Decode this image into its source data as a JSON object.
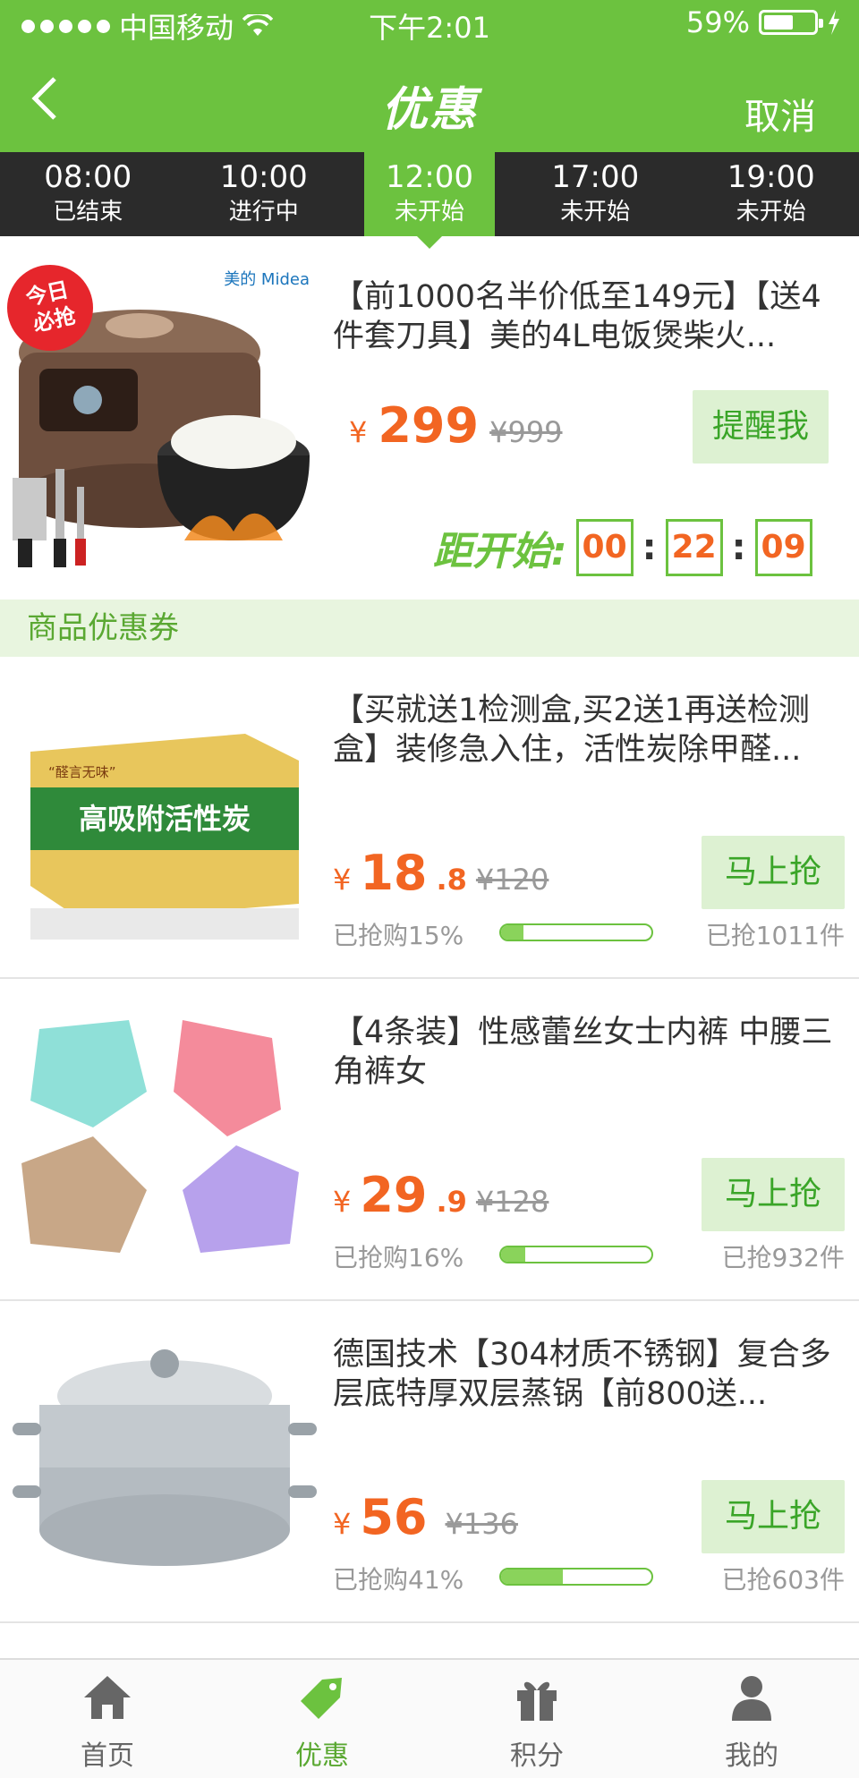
{
  "status_bar": {
    "carrier": "中国移动",
    "time": "下午2:01",
    "battery": "59%"
  },
  "header": {
    "title": "优惠",
    "cancel_label": "取消"
  },
  "time_tabs": [
    {
      "time": "08:00",
      "status": "已结束"
    },
    {
      "time": "10:00",
      "status": "进行中"
    },
    {
      "time": "12:00",
      "status": "未开始",
      "active": true
    },
    {
      "time": "17:00",
      "status": "未开始"
    },
    {
      "time": "19:00",
      "status": "未开始"
    }
  ],
  "featured": {
    "badge_text": "今日必抢",
    "brand_text": "美的 Midea",
    "title": "【前1000名半价低至149元】【送4件套刀具】美的4L电饭煲柴火...",
    "currency": "¥",
    "price": "299",
    "original_price": "¥999",
    "remind_label": "提醒我",
    "countdown_label": "距开始:",
    "countdown": {
      "h": "00",
      "m": "22",
      "s": "09"
    }
  },
  "section": {
    "title": "商品优惠券"
  },
  "products": [
    {
      "title": "【买就送1检测盒,买2送1再送检测盒】装修急入住，活性炭除甲醛...",
      "price_int": "18",
      "price_dec": ".8",
      "original_price": "¥120",
      "sold_label": "已抢购15%",
      "progress": 0.15,
      "count": "已抢1011件",
      "button": "马上抢",
      "image_text": "高吸附活性炭"
    },
    {
      "title": "【4条装】性感蕾丝女士内裤 中腰三角裤女",
      "price_int": "29",
      "price_dec": ".9",
      "original_price": "¥128",
      "sold_label": "已抢购16%",
      "progress": 0.16,
      "count": "已抢932件",
      "button": "马上抢"
    },
    {
      "title": "德国技术【304材质不锈钢】复合多层底特厚双层蒸锅【前800送...",
      "price_int": "56",
      "price_dec": "",
      "original_price": "¥136",
      "sold_label": "已抢购41%",
      "progress": 0.41,
      "count": "已抢603件",
      "button": "马上抢"
    }
  ],
  "tab_bar": [
    {
      "label": "首页",
      "icon": "home-icon"
    },
    {
      "label": "优惠",
      "icon": "tag-icon",
      "active": true
    },
    {
      "label": "积分",
      "icon": "gift-icon"
    },
    {
      "label": "我的",
      "icon": "user-icon"
    }
  ],
  "colors": {
    "brand_green": "#6cc23f",
    "price_orange": "#f26522",
    "dark_bar": "#2b2b2b"
  }
}
